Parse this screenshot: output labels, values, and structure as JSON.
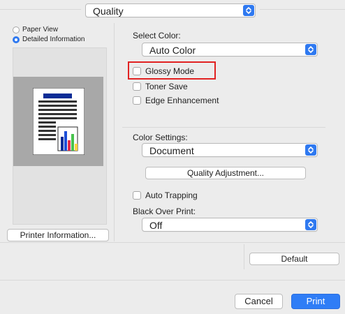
{
  "top": {
    "quality_popup": "Quality"
  },
  "left_panel": {
    "view_options": [
      {
        "label": "Paper View",
        "selected": false
      },
      {
        "label": "Detailed Information",
        "selected": true
      }
    ],
    "preview_thumbnail": {
      "chart_colors": [
        "#0a2c96",
        "#1d4fd8",
        "#e3284b",
        "#47c34d",
        "#ffd23f"
      ]
    },
    "printer_info_button": "Printer Information..."
  },
  "right_panel": {
    "select_color_label": "Select Color:",
    "select_color_value": "Auto Color",
    "glossy_mode_label": "Glossy Mode",
    "toner_save_label": "Toner Save",
    "edge_enhancement_label": "Edge Enhancement",
    "color_settings_label": "Color Settings:",
    "color_settings_value": "Document",
    "quality_adjustment_button": "Quality Adjustment...",
    "auto_trapping_label": "Auto Trapping",
    "black_over_print_label": "Black Over Print:",
    "black_over_print_value": "Off",
    "default_button": "Default"
  },
  "footer": {
    "cancel_button": "Cancel",
    "print_button": "Print"
  },
  "colors": {
    "accent_blue": "#2f79f0",
    "highlight_red": "#e12222",
    "panel_bg": "#ececec",
    "preview_gray": "#a8a8a8"
  }
}
